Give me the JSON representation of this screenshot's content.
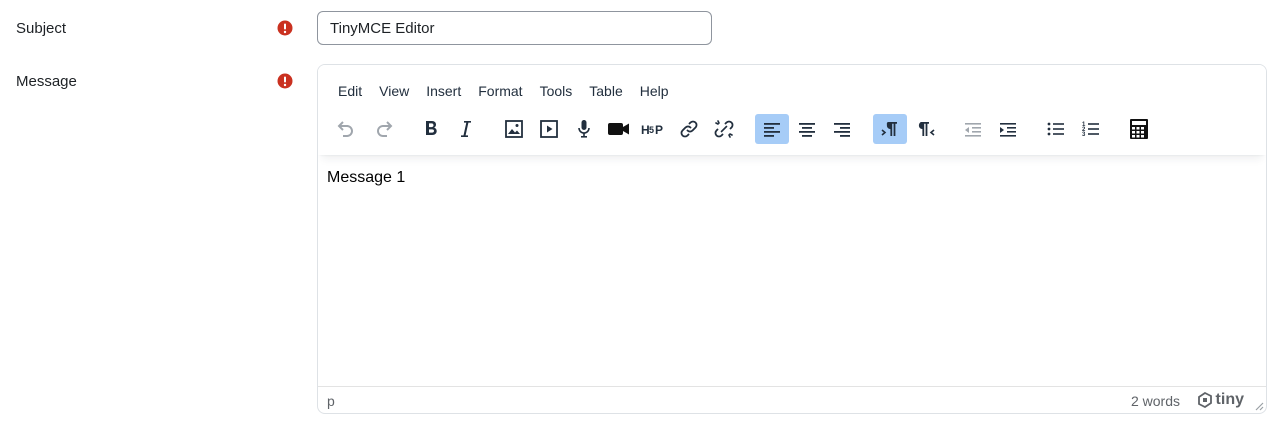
{
  "form": {
    "subject_label": "Subject",
    "subject_value": "TinyMCE Editor",
    "message_label": "Message",
    "required_color": "#ca3120"
  },
  "editor": {
    "menus": [
      "Edit",
      "View",
      "Insert",
      "Format",
      "Tools",
      "Table",
      "Help"
    ],
    "toolbar_icons": [
      "undo-icon",
      "redo-icon",
      "bold-icon",
      "italic-icon",
      "image-icon",
      "media-icon",
      "record-audio-icon",
      "record-video-icon",
      "h5p-icon",
      "link-icon",
      "unlink-icon",
      "align-left-icon",
      "align-center-icon",
      "align-right-icon",
      "ltr-icon",
      "rtl-icon",
      "outdent-icon",
      "indent-icon",
      "bullet-list-icon",
      "numbered-list-icon",
      "equation-icon"
    ],
    "active_color": "#a6ccf7",
    "content": "Message 1",
    "status_path": "p",
    "word_count": "2 words",
    "brand": "tiny"
  }
}
